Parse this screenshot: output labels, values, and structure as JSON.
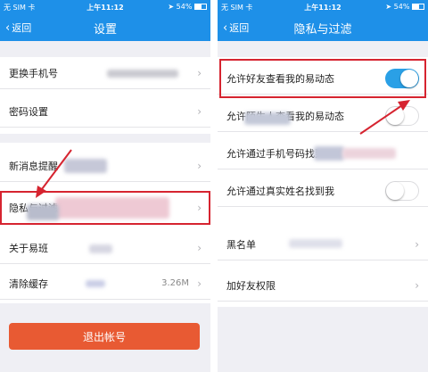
{
  "colors": {
    "primary": "#1e90e8",
    "danger": "#e85a33",
    "toggle_on": "#2aa0e6",
    "annotation": "#d62430"
  },
  "status_bar": {
    "carrier": "无 SIM 卡",
    "time": "上午11:12",
    "battery": "54%"
  },
  "left_screen": {
    "back_label": "返回",
    "title": "设置",
    "items": [
      {
        "label": "更换手机号"
      },
      {
        "label": "密码设置"
      },
      {
        "label": "新消息提醒"
      },
      {
        "label": "隐私与过滤"
      },
      {
        "label": "关于易班"
      },
      {
        "label": "清除缓存",
        "value": "3.26M"
      }
    ],
    "logout_label": "退出帐号"
  },
  "right_screen": {
    "back_label": "返回",
    "title": "隐私与过滤",
    "toggles": [
      {
        "label": "允许好友查看我的易动态",
        "on": true
      },
      {
        "label": "允许陌生人查看我的易动态",
        "on": false
      },
      {
        "label": "允许通过手机号码找到我",
        "on": false
      },
      {
        "label": "允许通过真实姓名找到我",
        "on": false
      }
    ],
    "links": [
      {
        "label": "黑名单"
      },
      {
        "label": "加好友权限"
      }
    ]
  },
  "icons": [
    "back-chevron-icon",
    "chevron-right-icon",
    "wifi-icon",
    "battery-icon",
    "arrow-annotation-icon"
  ]
}
